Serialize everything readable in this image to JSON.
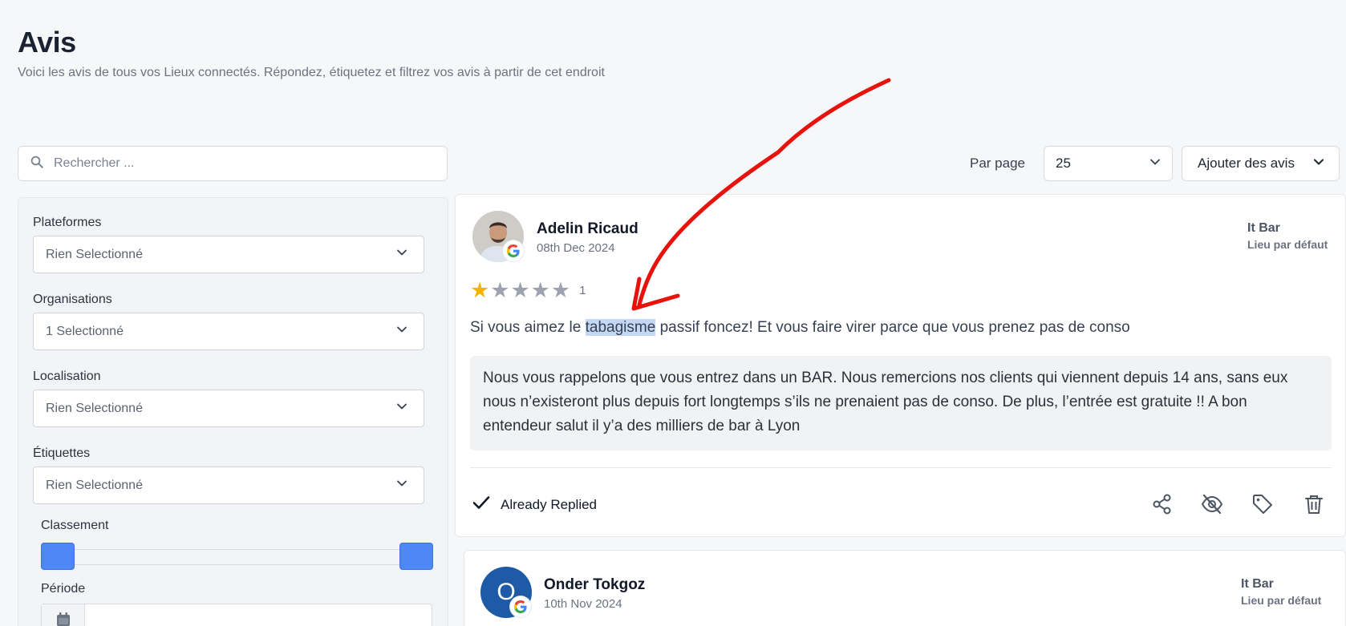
{
  "header": {
    "title": "Avis",
    "subtitle": "Voici les avis de tous vos Lieux connectés. Répondez, étiquetez et filtrez vos avis à partir de cet endroit"
  },
  "search": {
    "placeholder": "Rechercher ..."
  },
  "toolbar": {
    "per_page_label": "Par page",
    "per_page_value": "25",
    "add_reviews_label": "Ajouter des avis"
  },
  "filters": {
    "platforms": {
      "label": "Plateformes",
      "value": "Rien Selectionné"
    },
    "organisations": {
      "label": "Organisations",
      "value": "1 Selectionné"
    },
    "localisation": {
      "label": "Localisation",
      "value": "Rien Selectionné"
    },
    "tags": {
      "label": "Étiquettes",
      "value": "Rien Selectionné"
    },
    "ranking": {
      "label": "Classement",
      "min": 1,
      "max": 5
    },
    "period": {
      "label": "Période",
      "value": ""
    }
  },
  "reviews": [
    {
      "author": "Adelin Ricaud",
      "date": "08th Dec 2024",
      "platform_icon": "google-icon",
      "location_name": "It Bar",
      "location_sub": "Lieu par défaut",
      "rating": 1,
      "rating_label": "1",
      "text_before": "Si vous aimez le ",
      "text_highlight": "tabagisme",
      "text_after": " passif foncez! Et vous faire virer parce que vous prenez pas de conso",
      "reply": "Nous vous rappelons que vous entrez dans un BAR. Nous remercions nos clients qui viennent depuis 14 ans, sans eux nous n’existeront plus depuis fort longtemps s’ils ne prenaient pas de conso. De plus, l’entrée est gratuite !! A bon entendeur salut il y’a des milliers de bar à Lyon",
      "status": "Already Replied"
    },
    {
      "author": "Onder Tokgoz",
      "date": "10th Nov 2024",
      "avatar_letter": "O",
      "platform_icon": "google-icon",
      "location_name": "It Bar",
      "location_sub": "Lieu par défaut"
    }
  ],
  "colors": {
    "accent": "#4f87f6",
    "star": "#f5b301",
    "annotation": "#e8120c",
    "highlight": "#c4d8f5"
  }
}
